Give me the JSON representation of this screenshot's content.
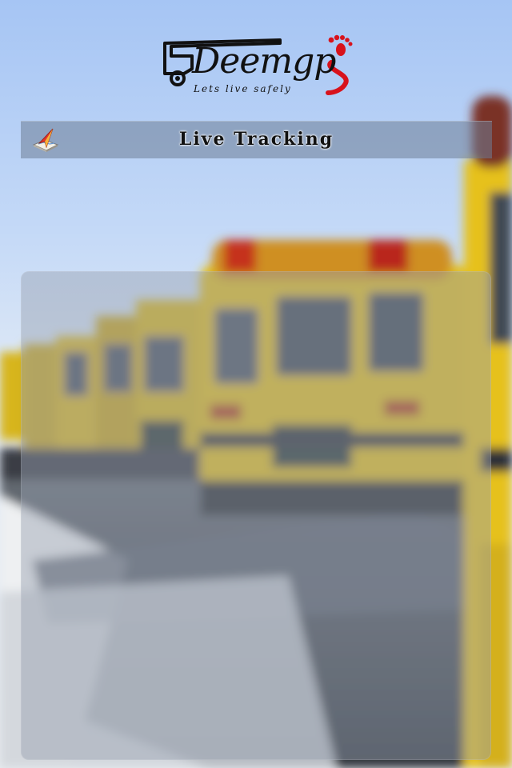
{
  "app": {
    "brand_name": "Deemgps",
    "logo_word": "Deemgp",
    "tagline": "Lets live safely"
  },
  "header": {
    "title": "Live Tracking",
    "icon": "map-arrow-icon"
  },
  "colors": {
    "brand_red": "#d8121b",
    "title_bar": "#7a889f",
    "sky": "#b9cff2",
    "bus_yellow": "#e8c31a"
  }
}
